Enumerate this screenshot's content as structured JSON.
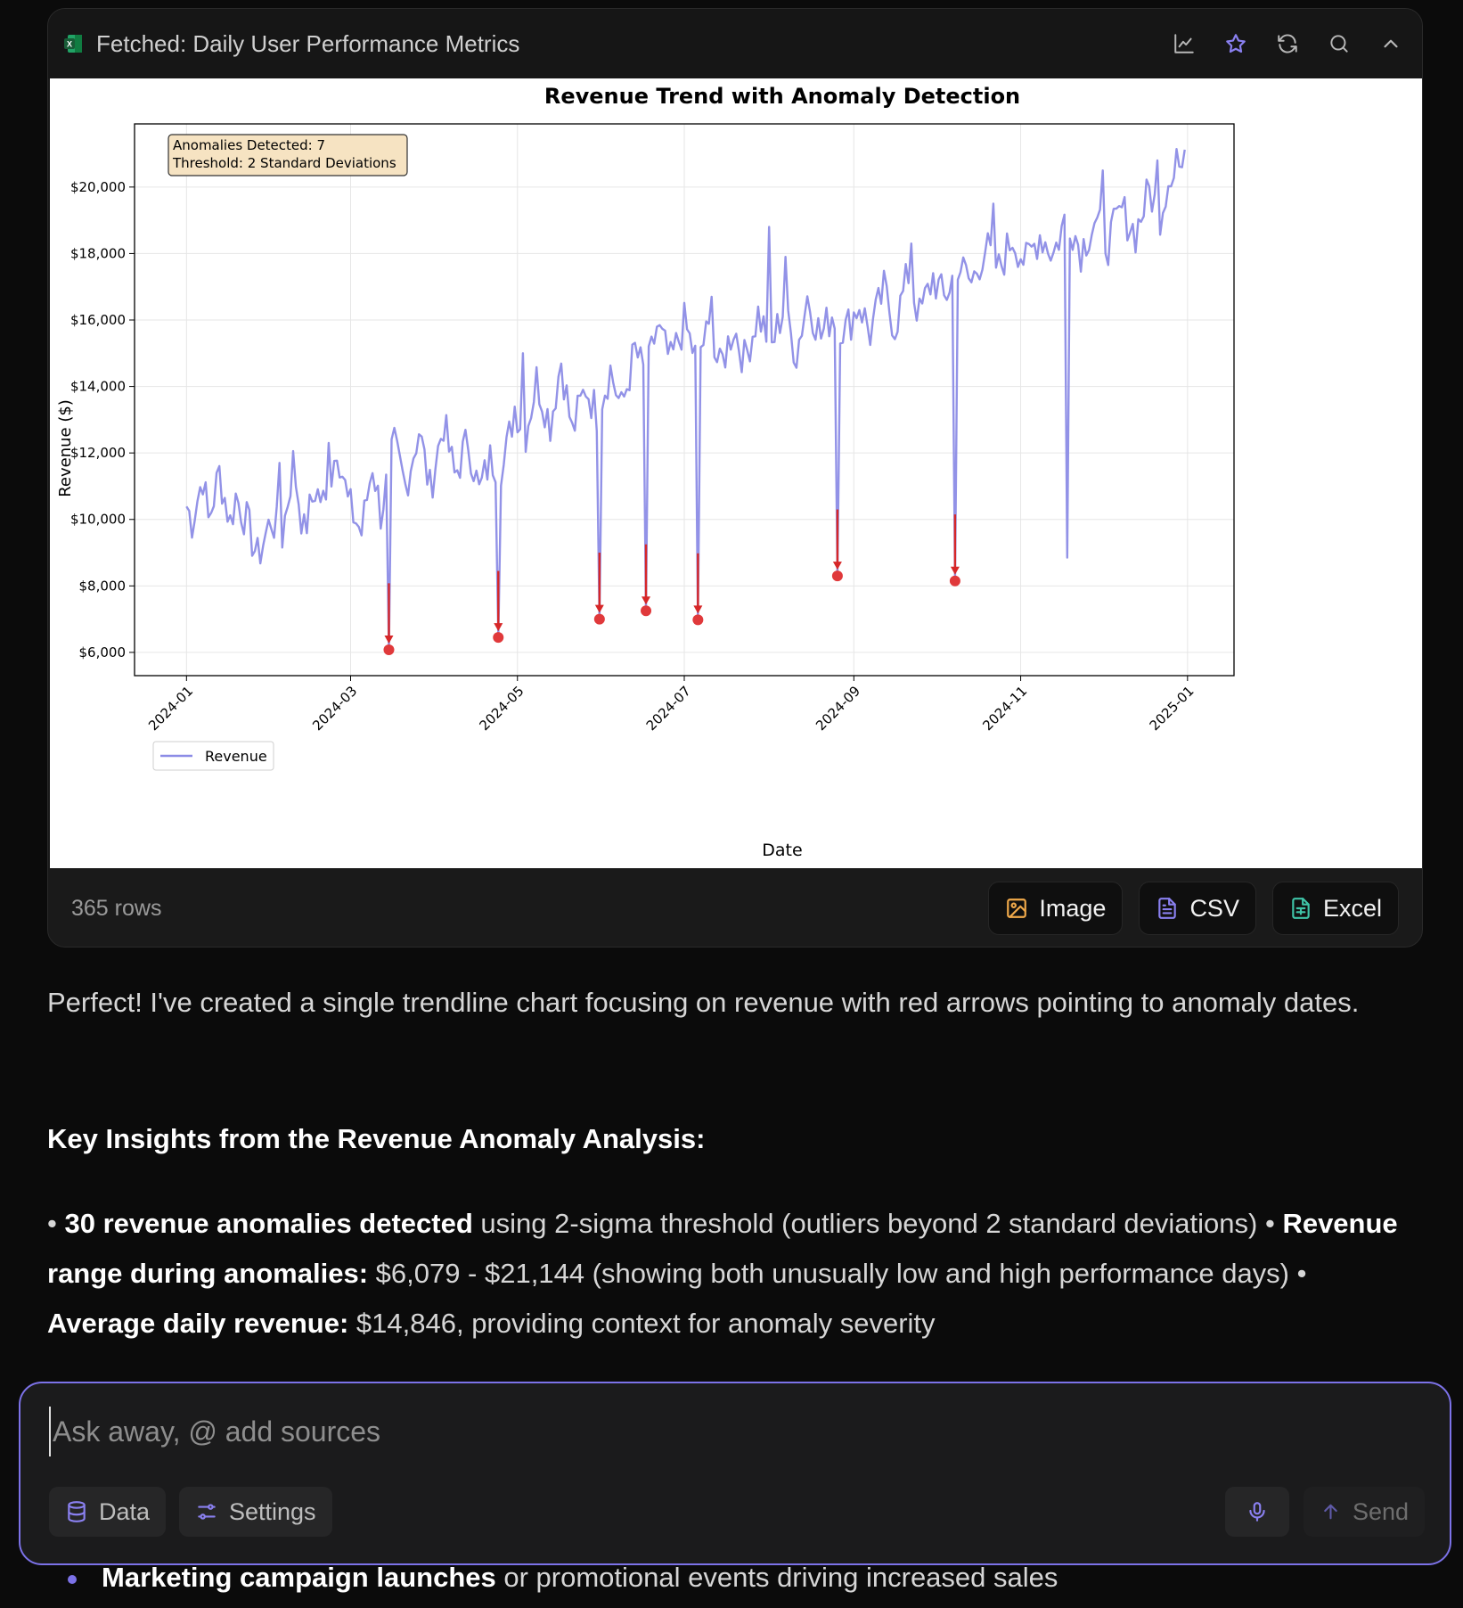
{
  "card": {
    "title": "Fetched: Daily User Performance Metrics",
    "row_count": "365 rows",
    "buttons": {
      "image": "Image",
      "csv": "CSV",
      "excel": "Excel"
    },
    "header_icons": [
      "chart-line-icon",
      "star-icon",
      "refresh-icon",
      "search-icon",
      "chevron-up-icon"
    ]
  },
  "chart_data": {
    "type": "line",
    "title": "Revenue Trend with Anomaly Detection",
    "xlabel": "Date",
    "ylabel": "Revenue ($)",
    "x_range": [
      "2024-01-01",
      "2024-12-31"
    ],
    "xlim": [
      "2023-12-13",
      "2025-01-18"
    ],
    "ylim": [
      5300,
      21900
    ],
    "x_ticks": [
      "2024-01",
      "2024-03",
      "2024-05",
      "2024-07",
      "2024-09",
      "2024-11",
      "2025-01"
    ],
    "y_ticks": [
      "$6,000",
      "$8,000",
      "$10,000",
      "$12,000",
      "$14,000",
      "$16,000",
      "$18,000",
      "$20,000"
    ],
    "y_tick_values": [
      6000,
      8000,
      10000,
      12000,
      14000,
      16000,
      18000,
      20000
    ],
    "legend": {
      "label": "Revenue",
      "position": "lower-left"
    },
    "annotation_box": {
      "line1": "Anomalies Detected: 7",
      "line2": "Threshold: 2 Standard Deviations",
      "position": "top-left"
    },
    "series": [
      {
        "name": "Revenue",
        "color": "#8c8ce6",
        "anchor_points": [
          [
            "2024-01-01",
            10400
          ],
          [
            "2024-01-03",
            9950
          ],
          [
            "2024-01-07",
            11300
          ],
          [
            "2024-01-09",
            9950
          ],
          [
            "2024-01-13",
            11400
          ],
          [
            "2024-01-17",
            9900
          ],
          [
            "2024-01-19",
            10700
          ],
          [
            "2024-01-23",
            9950
          ],
          [
            "2024-01-27",
            8850
          ],
          [
            "2024-02-01",
            10000
          ],
          [
            "2024-02-05",
            9500
          ],
          [
            "2024-02-09",
            11700
          ],
          [
            "2024-02-13",
            9600
          ],
          [
            "2024-02-17",
            10900
          ],
          [
            "2024-02-21",
            10400
          ],
          [
            "2024-02-25",
            12300
          ],
          [
            "2024-02-29",
            10500
          ],
          [
            "2024-03-05",
            9600
          ],
          [
            "2024-03-09",
            11700
          ],
          [
            "2024-03-12",
            10200
          ],
          [
            "2024-03-17",
            12200
          ],
          [
            "2024-03-21",
            11000
          ],
          [
            "2024-03-26",
            12700
          ],
          [
            "2024-03-30",
            10900
          ],
          [
            "2024-04-04",
            12900
          ],
          [
            "2024-04-08",
            11300
          ],
          [
            "2024-04-13",
            12400
          ],
          [
            "2024-04-17",
            10800
          ],
          [
            "2024-04-21",
            11800
          ],
          [
            "2024-04-26",
            11600
          ],
          [
            "2024-04-30",
            13400
          ],
          [
            "2024-05-04",
            12600
          ],
          [
            "2024-05-08",
            14200
          ],
          [
            "2024-05-13",
            12900
          ],
          [
            "2024-05-17",
            14800
          ],
          [
            "2024-05-21",
            12600
          ],
          [
            "2024-05-26",
            14000
          ],
          [
            "2024-05-30",
            13200
          ],
          [
            "2024-06-04",
            14500
          ],
          [
            "2024-06-08",
            13300
          ],
          [
            "2024-06-13",
            15100
          ],
          [
            "2024-06-17",
            14200
          ],
          [
            "2024-06-21",
            15800
          ],
          [
            "2024-06-26",
            14700
          ],
          [
            "2024-07-01",
            15900
          ],
          [
            "2024-07-05",
            14900
          ],
          [
            "2024-07-10",
            15600
          ],
          [
            "2024-07-14",
            14500
          ],
          [
            "2024-07-19",
            15800
          ],
          [
            "2024-07-23",
            14800
          ],
          [
            "2024-07-28",
            16200
          ],
          [
            "2024-08-02",
            15200
          ],
          [
            "2024-08-06",
            16300
          ],
          [
            "2024-08-11",
            15000
          ],
          [
            "2024-08-15",
            16700
          ],
          [
            "2024-08-20",
            15500
          ],
          [
            "2024-08-24",
            16200
          ],
          [
            "2024-08-29",
            15700
          ],
          [
            "2024-09-03",
            16500
          ],
          [
            "2024-09-07",
            15600
          ],
          [
            "2024-09-12",
            16900
          ],
          [
            "2024-09-16",
            15800
          ],
          [
            "2024-09-21",
            17400
          ],
          [
            "2024-09-25",
            16100
          ],
          [
            "2024-09-30",
            17300
          ],
          [
            "2024-10-04",
            16600
          ],
          [
            "2024-10-09",
            17700
          ],
          [
            "2024-10-14",
            17100
          ],
          [
            "2024-10-19",
            18200
          ],
          [
            "2024-10-24",
            17500
          ],
          [
            "2024-10-29",
            18500
          ],
          [
            "2024-11-03",
            17700
          ],
          [
            "2024-11-08",
            18600
          ],
          [
            "2024-11-13",
            18000
          ],
          [
            "2024-11-18",
            19200
          ],
          [
            "2024-11-23",
            18100
          ],
          [
            "2024-11-28",
            19000
          ],
          [
            "2024-12-03",
            18300
          ],
          [
            "2024-12-08",
            19300
          ],
          [
            "2024-12-13",
            18600
          ],
          [
            "2024-12-18",
            19900
          ],
          [
            "2024-12-22",
            19200
          ],
          [
            "2024-12-26",
            20600
          ],
          [
            "2024-12-31",
            20550
          ]
        ],
        "spikes": [
          [
            "2024-02-04",
            11700
          ],
          [
            "2024-02-22",
            12300
          ],
          [
            "2024-05-03",
            15000
          ],
          [
            "2024-07-11",
            16700
          ],
          [
            "2024-08-01",
            18800
          ],
          [
            "2024-08-07",
            17900
          ],
          [
            "2024-09-22",
            18300
          ],
          [
            "2024-10-22",
            19500
          ],
          [
            "2024-12-01",
            20500
          ],
          [
            "2024-12-21",
            20800
          ],
          [
            "2024-12-28",
            21144
          ]
        ]
      }
    ],
    "anomalies": [
      {
        "date": "2024-03-15",
        "value": 6079
      },
      {
        "date": "2024-04-24",
        "value": 6450
      },
      {
        "date": "2024-05-31",
        "value": 7000
      },
      {
        "date": "2024-06-17",
        "value": 7250
      },
      {
        "date": "2024-07-06",
        "value": 6980
      },
      {
        "date": "2024-08-26",
        "value": 8300
      },
      {
        "date": "2024-10-08",
        "value": 8150
      }
    ],
    "unmarked_dips": [
      {
        "date": "2024-11-18",
        "value": 8850
      }
    ],
    "anomaly_color": "#d62728"
  },
  "message": {
    "intro": "Perfect! I've created a single trendline chart focusing on revenue with red arrows pointing to anomaly dates.",
    "heading": "Key Insights from the Revenue Anomaly Analysis:",
    "bullets": {
      "b1_bold": "30 revenue anomalies detected",
      "b1_text": " using 2-sigma threshold (outliers beyond 2 standard deviations) •",
      "b2_bold": "Revenue range during anomalies:",
      "b2_text": " $6,079 - $21,144 (showing both unusually low and high performance days) •",
      "b3_bold": "Average daily revenue:",
      "b3_text": " $14,846, providing context for anomaly severity"
    }
  },
  "composer": {
    "placeholder": "Ask away, @ add sources",
    "data_label": "Data",
    "settings_label": "Settings",
    "send_label": "Send"
  },
  "peek": {
    "bold": "Marketing campaign launches",
    "text": " or promotional events driving increased sales"
  },
  "colors": {
    "accent": "#7c72e8",
    "background": "#0b0b0b",
    "card": "#1a1a1a"
  }
}
